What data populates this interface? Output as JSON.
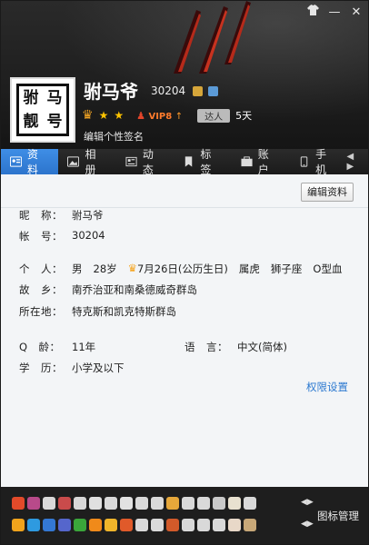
{
  "window_controls": [
    "▾",
    "—",
    "✕"
  ],
  "profile": {
    "nickname": "驸马爷",
    "qq_number": "30204",
    "avatar_chars": [
      "驸",
      "马",
      "靓",
      "号"
    ],
    "vip_label": "VIP8",
    "talent_label": "达人",
    "talent_days": "5天",
    "signature_link": "编辑个性签名"
  },
  "tabs": [
    {
      "label": "资料",
      "icon": "profile-card-icon",
      "active": true
    },
    {
      "label": "相册",
      "icon": "photo-album-icon"
    },
    {
      "label": "动态",
      "icon": "feed-icon"
    },
    {
      "label": "标签",
      "icon": "tag-icon"
    },
    {
      "label": "账户",
      "icon": "wallet-icon"
    },
    {
      "label": "手机",
      "icon": "phone-icon"
    }
  ],
  "edit_button": "编辑资料",
  "info": {
    "nick_label": "昵　称：",
    "nick_value": "驸马爷",
    "account_label": "帐　号：",
    "account_value": "30204",
    "personal_label": "个　人：",
    "gender": "男",
    "age": "28岁",
    "birthday": "7月26日(公历生日)",
    "zodiac": "属虎",
    "star_sign": "狮子座",
    "blood": "O型血",
    "hometown_label": "故　乡：",
    "hometown_value": "南乔治亚和南桑德威奇群岛",
    "location_label": "所在地：",
    "location_value": "特克斯和凯克特斯群岛",
    "qage_label": "Q　龄：",
    "qage_value": "11年",
    "language_label": "语　言：",
    "language_value": "中文(简体)",
    "edu_label": "学　历：",
    "edu_value": "小学及以下",
    "permission_link": "权限设置"
  },
  "footer": {
    "icon_manage_label": "图标管理",
    "row1_icons": [
      "fire-icon",
      "gem-icon",
      "pet-icon",
      "game-icon",
      "music-icon",
      "mail-icon",
      "cloud-icon",
      "chat-icon",
      "video-icon",
      "book-icon",
      "star-icon",
      "pen-icon",
      "wallet-icon",
      "shop-icon",
      "doc-icon",
      "person-icon"
    ],
    "row2_icons": [
      "star-icon",
      "photo-icon",
      "qq-icon",
      "tv-icon",
      "clover-icon",
      "smile-icon",
      "heart-icon",
      "ball-icon",
      "sound-icon",
      "film-icon",
      "badge-icon",
      "cloud-icon",
      "brush-icon",
      "pet-icon",
      "mail-icon",
      "ring-icon"
    ],
    "row1_colors": [
      "#e24a2a",
      "#b84a8a",
      "#d9d9d9",
      "#c94b4b",
      "#d8d8d8",
      "#e0e0e0",
      "#d9d9d9",
      "#e2e2e2",
      "#d9d9d9",
      "#d9d9d9",
      "#e6a73a",
      "#d9d9d9",
      "#d9d9d9",
      "#c9c9c9",
      "#e8e1d0",
      "#d9d9d9"
    ],
    "row2_colors": [
      "#f0a31c",
      "#2e9ae0",
      "#3478d4",
      "#5566cc",
      "#3aa63a",
      "#f08a1a",
      "#f0b52a",
      "#e05a2a",
      "#d9d9d9",
      "#d9d9d9",
      "#d25a2a",
      "#d9d9d9",
      "#d9d9d9",
      "#d9d9d9",
      "#e8d8c8",
      "#c8a878"
    ]
  }
}
